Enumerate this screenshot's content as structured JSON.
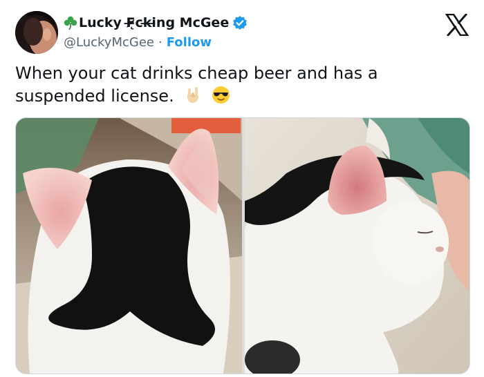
{
  "author": {
    "display_name": "Lucky F̶̷̨ck̶i̶ng McGee",
    "handle": "@LuckyMcGee",
    "separator": "·",
    "follow_label": "Follow",
    "verified": true,
    "name_prefix_icon": "shamrock-icon"
  },
  "platform_icon": "x-logo-icon",
  "tweet": {
    "text": "When your cat drinks cheap beer and has a suspended license.",
    "emojis": [
      "horns-hand-emoji",
      "sunglasses-face-emoji"
    ]
  },
  "colors": {
    "accent": "#1d9bf0",
    "text": "#0f1419",
    "secondary_text": "#536471",
    "border": "#cfd9de"
  },
  "media": {
    "photos": [
      {
        "description": "black-and-white cat, back of head with mustache-shaped black marking"
      },
      {
        "description": "same cat in profile with eyes closed"
      }
    ]
  }
}
